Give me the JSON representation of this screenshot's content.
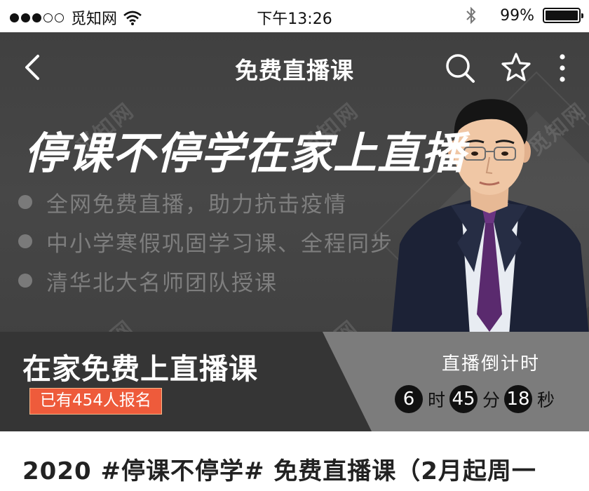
{
  "status_bar": {
    "carrier": "觅知网",
    "time": "下午13:26",
    "battery": "99%"
  },
  "nav": {
    "title": "免费直播课",
    "icons": [
      "back-chevron-icon",
      "search-icon",
      "star-icon",
      "more-vertical-icon"
    ]
  },
  "hero": {
    "headline": "停课不停学在家上直播",
    "bullets": [
      "全网免费直播，助力抗击疫情",
      "中小学寒假巩固学习课、全程同步",
      "清华北大名师团队授课"
    ]
  },
  "banner": {
    "title": "在家免费上直播课",
    "signup_badge": "已有454人报名",
    "countdown_label": "直播倒计时",
    "countdown": {
      "hours": "6",
      "hours_unit": "时",
      "minutes": "45",
      "minutes_unit": "分",
      "seconds": "18",
      "seconds_unit": "秒"
    }
  },
  "article": {
    "title": "2020 #停课不停学# 免费直播课（2月起周一"
  },
  "watermark": "觅知网",
  "colors": {
    "hero_bg": "#434343",
    "banner_dark": "#353535",
    "banner_light": "#7c7c7c",
    "badge": "#ee5b3b"
  }
}
